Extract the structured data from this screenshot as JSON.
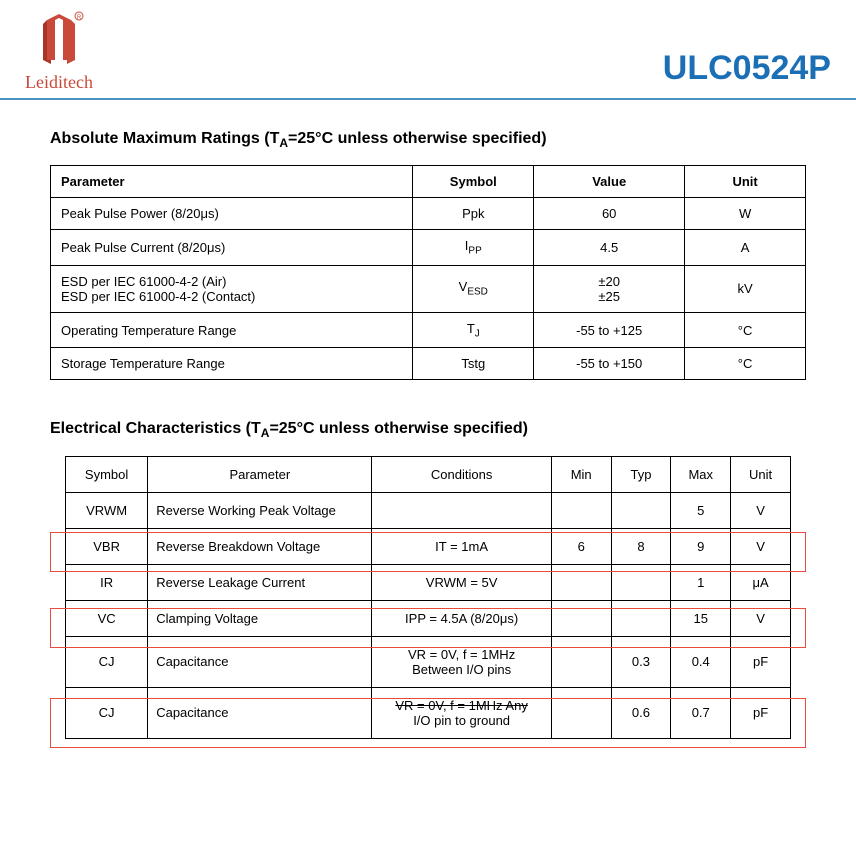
{
  "header": {
    "brand": "Leiditech",
    "part_number": "ULC0524P"
  },
  "section1": {
    "title_prefix": "Absolute Maximum Ratings (T",
    "title_sub": "A",
    "title_suffix": "=25°C unless otherwise specified)",
    "headers": [
      "Parameter",
      "Symbol",
      "Value",
      "Unit"
    ],
    "rows": [
      {
        "param": "Peak Pulse Power (8/20μs)",
        "symbol": "Ppk",
        "value": "60",
        "unit": "W"
      },
      {
        "param": "Peak Pulse Current (8/20μs)",
        "symbol_pre": "I",
        "symbol_sub": "PP",
        "value": "4.5",
        "unit": "A"
      },
      {
        "param_line1": "ESD per IEC 61000-4-2 (Air)",
        "param_line2": "ESD per IEC 61000-4-2 (Contact)",
        "symbol_pre": "V",
        "symbol_sub": "ESD",
        "value_line1": "±20",
        "value_line2": "±25",
        "unit": "kV"
      },
      {
        "param": "Operating Temperature Range",
        "symbol_pre": "T",
        "symbol_sub": "J",
        "value": "-55 to +125",
        "unit": "°C"
      },
      {
        "param": "Storage Temperature Range",
        "symbol": "Tstg",
        "value": "-55 to +150",
        "unit": "°C"
      }
    ]
  },
  "section2": {
    "title_prefix": "Electrical Characteristics (T",
    "title_sub": "A",
    "title_suffix": "=25°C unless otherwise specified)",
    "headers": [
      "Symbol",
      "Parameter",
      "Conditions",
      "Min",
      "Typ",
      "Max",
      "Unit"
    ],
    "rows": [
      {
        "symbol": "VRWM",
        "param": "Reverse Working Peak Voltage",
        "cond": "",
        "min": "",
        "typ": "",
        "max": "5",
        "unit": "V"
      },
      {
        "symbol": "VBR",
        "param": "Reverse Breakdown Voltage",
        "cond": "IT = 1mA",
        "min": "6",
        "typ": "8",
        "max": "9",
        "unit": "V"
      },
      {
        "symbol": "IR",
        "param": "Reverse Leakage Current",
        "cond": "VRWM = 5V",
        "min": "",
        "typ": "",
        "max": "1",
        "unit": "μA"
      },
      {
        "symbol": "VC",
        "param": "Clamping Voltage",
        "cond": "IPP = 4.5A (8/20μs)",
        "min": "",
        "typ": "",
        "max": "15",
        "unit": "V"
      },
      {
        "symbol": "CJ",
        "param": "Capacitance",
        "cond_l1": "VR = 0V, f = 1MHz",
        "cond_l2": "Between I/O pins",
        "min": "",
        "typ": "0.3",
        "max": "0.4",
        "unit": "pF"
      },
      {
        "symbol": "CJ",
        "param": "Capacitance",
        "cond_l1": "VR = 0V, f = 1MHz Any",
        "cond_l2": "I/O pin to ground",
        "min": "",
        "typ": "0.6",
        "max": "0.7",
        "unit": "pF"
      }
    ]
  }
}
